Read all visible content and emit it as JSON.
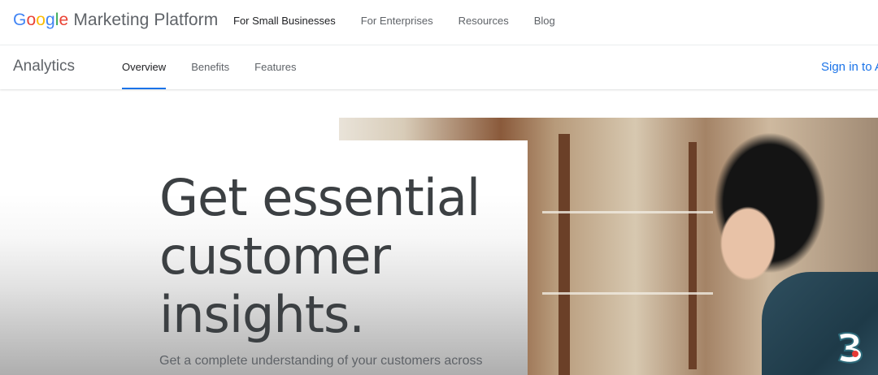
{
  "top_nav": {
    "logo": {
      "google_letters": [
        {
          "char": "G",
          "color": "#4285f4"
        },
        {
          "char": "o",
          "color": "#ea4335"
        },
        {
          "char": "o",
          "color": "#fbbc05"
        },
        {
          "char": "g",
          "color": "#4285f4"
        },
        {
          "char": "l",
          "color": "#34a853"
        },
        {
          "char": "e",
          "color": "#ea4335"
        }
      ],
      "suffix": "Marketing Platform"
    },
    "links": [
      "For Small Businesses",
      "For Enterprises",
      "Resources",
      "Blog"
    ],
    "active_link": "For Small Businesses"
  },
  "sub_nav": {
    "product": "Analytics",
    "tabs": [
      "Overview",
      "Benefits",
      "Features"
    ],
    "active_tab": "Overview",
    "sign_in": "Sign in to A"
  },
  "hero": {
    "headline": "Get essential customer insights.",
    "subtext": "Get a complete understanding of your customers across",
    "image": "woman-at-shop-photo"
  },
  "colors": {
    "accent": "#1a73e8",
    "text_dark": "#202124",
    "text_muted": "#5f6368"
  },
  "icons": {
    "watermark": "b-logo-icon"
  }
}
